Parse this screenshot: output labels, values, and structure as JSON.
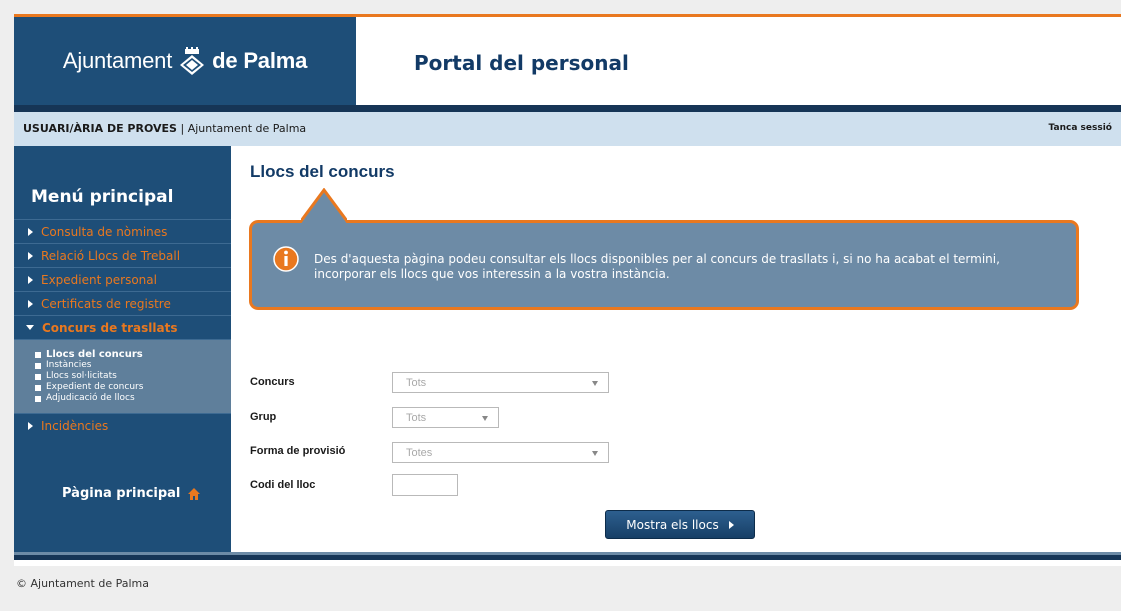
{
  "header": {
    "logo_text_light": "Ajuntament",
    "logo_text_bold": "de Palma",
    "portal_title": "Portal del personal"
  },
  "user_bar": {
    "user_name": "USUARI/ÀRIA DE PROVES",
    "separator": " | ",
    "organization": "Ajuntament de Palma",
    "logout_label": "Tanca sessió"
  },
  "sidebar": {
    "title": "Menú principal",
    "items": [
      {
        "label": "Consulta de nòmines"
      },
      {
        "label": "Relació Llocs de Treball"
      },
      {
        "label": "Expedient personal"
      },
      {
        "label": "Certificats de registre"
      },
      {
        "label": "Concurs de trasllats",
        "active": true
      },
      {
        "label": "Incidències"
      }
    ],
    "subitems": [
      {
        "label": "Llocs del concurs",
        "current": true
      },
      {
        "label": "Instàncies"
      },
      {
        "label": "Llocs sol·licitats"
      },
      {
        "label": "Expedient de concurs"
      },
      {
        "label": "Adjudicació de llocs"
      }
    ],
    "home_label": "Pàgina principal"
  },
  "main": {
    "title": "Llocs del concurs",
    "info_text": "Des d'aquesta pàgina podeu consultar els llocs disponibles per al concurs de trasllats i, si no ha acabat el termini, incorporar els llocs que vos interessin a la vostra instància.",
    "form": {
      "concurs_label": "Concurs",
      "concurs_value": "Tots",
      "grup_label": "Grup",
      "grup_value": "Tots",
      "provisio_label": "Forma de provisió",
      "provisio_value": "Totes",
      "codi_label": "Codi del lloc",
      "codi_value": ""
    },
    "submit_label": "Mostra els llocs"
  },
  "footer": {
    "copyright": "© Ajuntament de Palma"
  },
  "colors": {
    "brand_blue": "#1e4e78",
    "accent_orange": "#e9781f",
    "callout_blue": "#6d8ba6"
  },
  "icons": [
    "emblem-icon",
    "info-icon",
    "home-icon",
    "chevron-right-icon",
    "chevron-down-icon"
  ]
}
